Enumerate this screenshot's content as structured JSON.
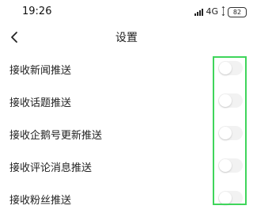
{
  "status_bar": {
    "time": "19:26",
    "network": "4G",
    "battery": "82"
  },
  "header": {
    "title": "设置"
  },
  "settings": [
    {
      "label": "接收新闻推送",
      "enabled": false
    },
    {
      "label": "接收话题推送",
      "enabled": false
    },
    {
      "label": "接收企鹅号更新推送",
      "enabled": false
    },
    {
      "label": "接收评论消息推送",
      "enabled": false
    },
    {
      "label": "接收粉丝推送",
      "enabled": false
    }
  ],
  "colors": {
    "highlight": "#3fd55b",
    "toggle_off": "#f2f2f2"
  }
}
